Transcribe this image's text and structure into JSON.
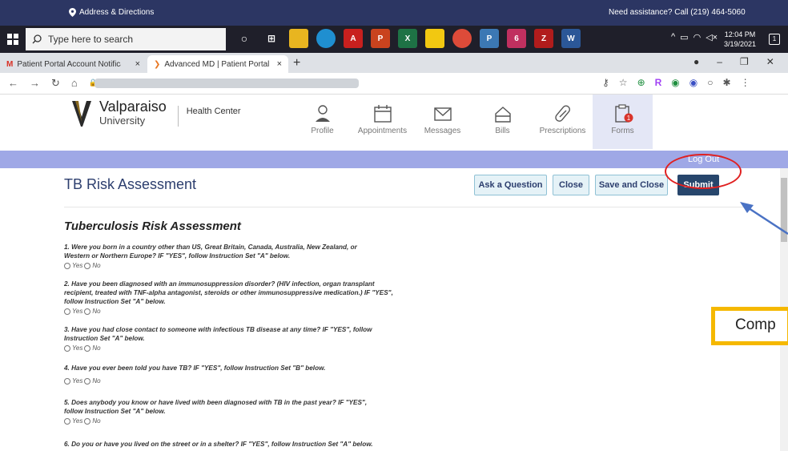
{
  "banner": {
    "address": "Address & Directions",
    "assistance": "Need assistance? Call (219) 464-5060"
  },
  "taskbar": {
    "search_placeholder": "Type here to search",
    "time": "12:04 PM",
    "date": "3/19/2021"
  },
  "tabs": [
    {
      "label": "Patient Portal Account Notificatio"
    },
    {
      "label": "Advanced MD | Patient Portal"
    }
  ],
  "portal": {
    "logo_name": "Valparaiso",
    "logo_sub": "University",
    "logo_dept": "Health Center",
    "nav": [
      {
        "label": "Profile"
      },
      {
        "label": "Appointments"
      },
      {
        "label": "Messages"
      },
      {
        "label": "Bills"
      },
      {
        "label": "Prescriptions"
      },
      {
        "label": "Forms",
        "badge": "1"
      }
    ],
    "logout": "Log Out"
  },
  "page": {
    "title": "TB Risk Assessment",
    "buttons": {
      "ask": "Ask a Question",
      "close": "Close",
      "save_close": "Save and Close",
      "submit": "Submit"
    },
    "form_title": "Tuberculosis Risk Assessment",
    "yes": "Yes",
    "no": "No",
    "questions": [
      "1. Were you born in a country other than US, Great Britain, Canada, Australia, New Zealand, or Western or Northern Europe? IF \"YES\", follow Instruction Set \"A\" below.",
      "2. Have you been diagnosed with an immunosuppression disorder? (HIV infection, organ transplant recipient, treated with TNF-alpha antagonist, steroids or other immunosuppressive medication.) IF \"YES\", follow Instruction Set \"A\" below.",
      "3. Have you had close contact to someone with infectious TB disease at any time? IF \"YES\", follow Instruction Set \"A\" below.",
      "4. Have you ever been told you have TB? IF \"YES\", follow Instruction Set \"B\" below.",
      "5. Does anybody you know or have lived with been diagnosed with TB in the past year? IF \"YES\", follow Instruction Set \"A\" below.",
      "6. Do you or have you lived on the street or in a shelter? IF \"YES\", follow Instruction Set \"A\" below."
    ]
  },
  "annotation": {
    "callout": "Comp"
  },
  "colors": {
    "banner": "#2c3663",
    "logout_bar": "#9fa8e6",
    "submit": "#27466c",
    "highlight_circle": "#e02020",
    "callout_border": "#f5b800",
    "arrow": "#4a72c4"
  }
}
